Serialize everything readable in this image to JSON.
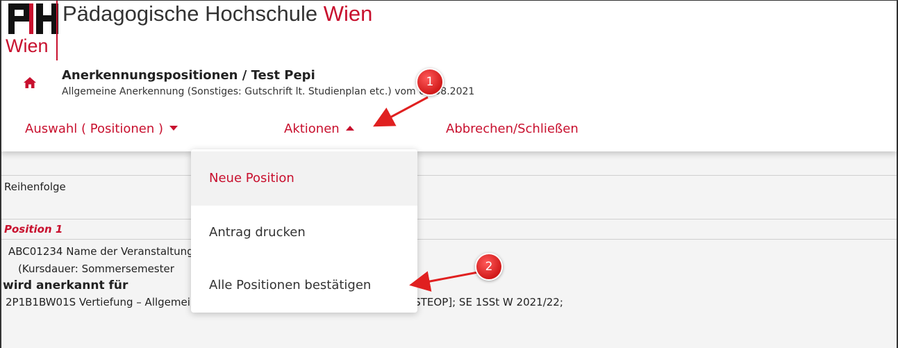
{
  "header": {
    "logo_wien": "Wien",
    "institution_name_main": "Pädagogische Hochschule ",
    "institution_name_accent": "Wien",
    "title": "Anerkennungspositionen  / Test Pepi",
    "subtitle": "Allgemeine Anerkennung (Sonstiges: Gutschrift lt. Studienplan etc.) vom 01.08.2021",
    "home_icon": "home-icon",
    "brand_color": "#c8102e"
  },
  "menu": {
    "auswahl_label": "Auswahl ( Positionen )",
    "aktionen_label": "Aktionen",
    "abbrechen_label": "Abbrechen/Schließen"
  },
  "dropdown": {
    "items": [
      {
        "label": "Neue Position"
      },
      {
        "label": "Antrag drucken"
      },
      {
        "label": "Alle Positionen bestätigen"
      }
    ]
  },
  "content": {
    "reihenfolge": "Reihenfolge",
    "position_label": "Position 1",
    "course_line": "ABC01234 Name der Veranstaltung",
    "duration_line": "(Kursdauer: Sommersemester",
    "recognized_for": "wird anerkannt für",
    "target_line": "2P1B1BW01S Vertiefung – Allgemeine bildungswissenschaftliche Grundlagen [STEOP]; SE 1SSt W 2021/22;"
  },
  "annotations": {
    "badge_1": "1",
    "badge_2": "2",
    "color": "#e02020"
  }
}
